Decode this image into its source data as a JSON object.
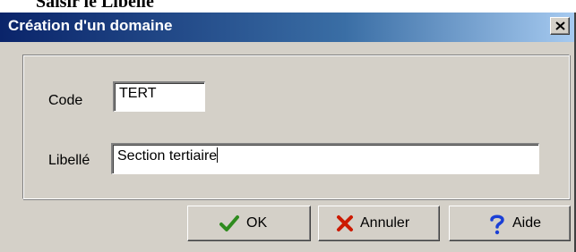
{
  "background_text": "Saisir le Libellé",
  "window": {
    "title": "Création d'un domaine",
    "close_icon": "close-icon"
  },
  "form": {
    "code": {
      "label": "Code",
      "value": "TERT"
    },
    "libelle": {
      "label": "Libellé",
      "value": "Section tertiaire"
    }
  },
  "buttons": {
    "ok": {
      "label": "OK",
      "icon": "checkmark-icon",
      "icon_color": "#2e8b1e"
    },
    "annuler": {
      "label": "Annuler",
      "icon": "cross-icon",
      "icon_color": "#cc1a00"
    },
    "aide": {
      "label": "Aide",
      "icon": "question-mark-icon",
      "icon_color": "#1a3fd6"
    }
  }
}
